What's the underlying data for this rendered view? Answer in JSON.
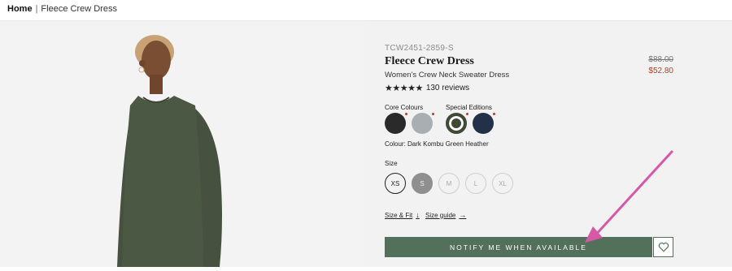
{
  "breadcrumb": {
    "home": "Home",
    "separator": "|",
    "current": "Fleece Crew Dress"
  },
  "product": {
    "sku": "TCW2451-2859-S",
    "title": "Fleece Crew Dress",
    "subtitle": "Women's Crew Neck Sweater Dress",
    "price_original": "$88.00",
    "price_sale": "$52.80",
    "rating_stars": "★★★★★",
    "reviews": "130 reviews"
  },
  "colours": {
    "core_label": "Core Colours",
    "special_label": "Special Editions",
    "selected_text": "Colour: Dark Kombu Green Heather",
    "core": [
      {
        "name": "black",
        "hex": "#2a2a2a"
      },
      {
        "name": "grey",
        "hex": "#a9aeb2"
      }
    ],
    "special": [
      {
        "name": "dark-kombu-green",
        "hex": "#3e4a35"
      },
      {
        "name": "navy",
        "hex": "#22304a"
      }
    ]
  },
  "size": {
    "label": "Size",
    "options": [
      "XS",
      "S",
      "M",
      "L",
      "XL"
    ]
  },
  "links": {
    "size_fit": "Size & Fit",
    "size_guide": "Size guide"
  },
  "cta": {
    "notify": "NOTIFY ME WHEN AVAILABLE"
  },
  "colors": {
    "button_green": "#52705a",
    "sale_price": "#b0452a",
    "annotation_arrow": "#d858a8"
  }
}
